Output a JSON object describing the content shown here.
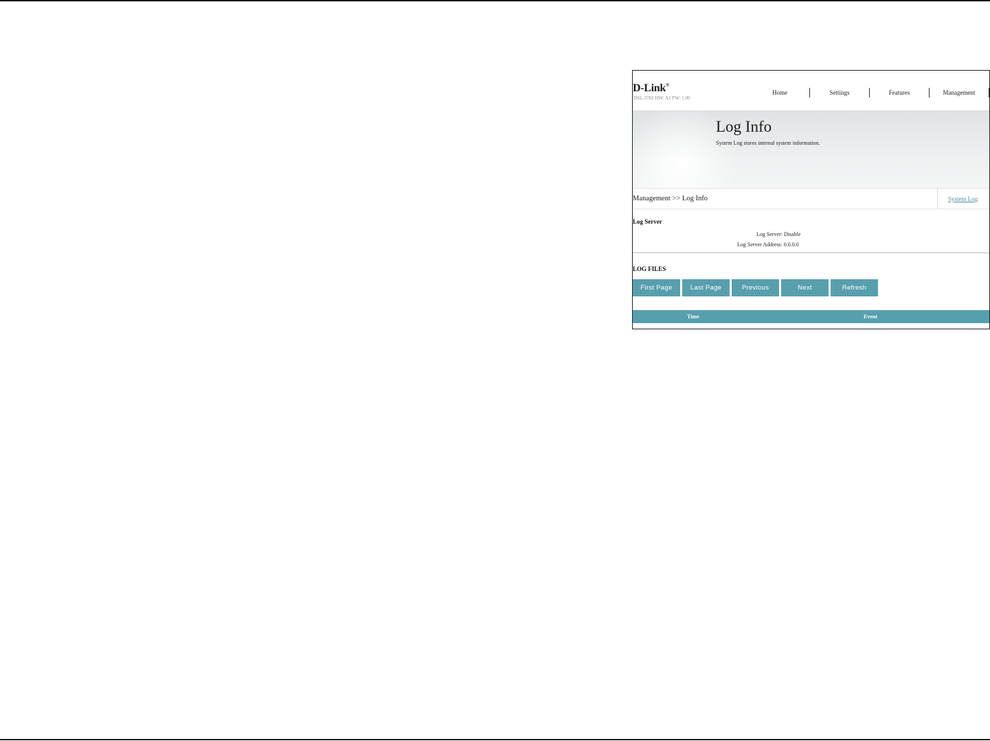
{
  "header": {
    "logo_text": "D-Link",
    "logo_mark": "®",
    "device_info": "DSL-3782  HW: A1  FW: 1.00",
    "nav": [
      "Home",
      "Settings",
      "Features",
      "Management"
    ]
  },
  "banner": {
    "title": "Log Info",
    "description": "System Log stores internal system information."
  },
  "breadcrumb": {
    "text": "Management >> Log Info",
    "tab_link": "System Log"
  },
  "log_server": {
    "section_title": "Log Server",
    "status": "Log Server: Disable",
    "address": "Log Server Address: 0.0.0.0"
  },
  "log_files": {
    "section_title": "LOG FILES",
    "buttons": [
      "First Page",
      "Last Page",
      "Previous",
      "Next",
      "Refresh"
    ],
    "columns": [
      "Time",
      "Event"
    ]
  },
  "colors": {
    "accent": "#589fae",
    "link": "#4a8fa0"
  }
}
